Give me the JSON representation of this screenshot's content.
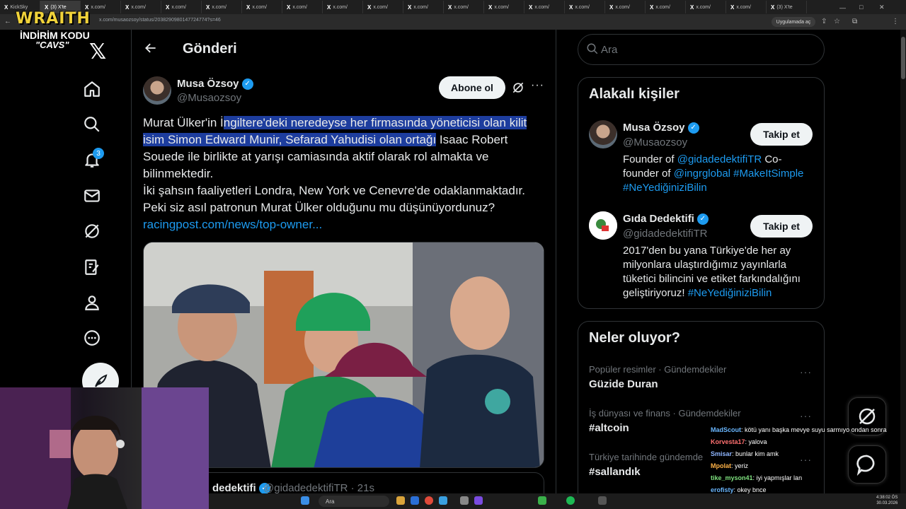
{
  "browser": {
    "tabs": [
      "KickSky",
      "(3) X'te",
      "x.com/",
      "x.com/",
      "x.com/",
      "x.com/",
      "x.com/",
      "x.com/",
      "x.com/",
      "x.com/",
      "x.com/",
      "x.com/",
      "x.com/",
      "x.com/",
      "x.com/",
      "x.com/",
      "x.com/",
      "x.com/",
      "x.com/",
      "(3) X'te"
    ],
    "url": "x.com/musaozsoy/status/2038290980147724774?s=46",
    "open_in_app": "Uygulamada aç"
  },
  "overlay": {
    "brand": "WRAITH",
    "discount": "İNDİRİM KODU",
    "code": "\"CAVS\""
  },
  "nav": {
    "notifications_count": "3"
  },
  "post": {
    "page_title": "Gönderi",
    "author_name": "Musa Özsoy",
    "author_handle": "@Musaozsoy",
    "subscribe_label": "Abone ol",
    "more": "···",
    "text_before_highlight": "Murat Ülker'in İ",
    "text_highlight": "ngiltere'deki neredeyse her firmasında yöneticisi olan kilit isim Simon Edward Munir, Sefarad Yahudisi olan ortağı",
    "text_after_highlight": " Isaac Robert Souede ile birlikte at yarışı camiasında aktif olarak rol almakta ve bilinmektedir.",
    "line2": "İki şahsın faaliyetleri Londra, New York ve Cenevre'de odaklanmaktadır.",
    "line3": "Peki siz asıl patronun Murat Ülker olduğunu mu düşünüyordunuz?",
    "link": "racingpost.com/news/top-owner..."
  },
  "reply": {
    "name": "dedektifi",
    "handle": "@gidadedektifiTR · 21s"
  },
  "search": {
    "placeholder": "Ara"
  },
  "related": {
    "title": "Alakalı kişiler",
    "people": [
      {
        "name": "Musa Özsoy",
        "handle": "@Musaozsoy",
        "follow_label": "Takip et",
        "bio_1": "Founder of ",
        "bio_link1": "@gidadedektifiTR",
        "bio_2": " Co-founder of ",
        "bio_link2": "@ingrglobal",
        "bio_3": " ",
        "bio_link3": "#MakeItSimple",
        "bio_link4": "#NeYediğiniziBilin"
      },
      {
        "name": "Gıda Dedektifi",
        "handle": "@gidadedektifiTR",
        "follow_label": "Takip et",
        "bio_1": "2017'den bu yana Türkiye'de her ay milyonlara ulaştırdığımız yayınlarla tüketici bilincini ve etiket farkındalığını geliştiriyoruz! ",
        "bio_link1": "#NeYediğiniziBilin"
      }
    ]
  },
  "trends": {
    "title": "Neler oluyor?",
    "items": [
      {
        "meta": "Popüler resimler · Gündemdekiler",
        "name": "Güzide Duran"
      },
      {
        "meta": "İş dünyası ve finans · Gündemdekiler",
        "name": "#altcoin"
      },
      {
        "meta": "Türkiye tarihinde gündemde",
        "name": "#sallandık"
      }
    ]
  },
  "chat": [
    {
      "user": "MadScout",
      "color": "#6ab7ff",
      "msg": ": kötü yanı başka mevye suyu sarmıyo ondan sonra"
    },
    {
      "user": "Korvesta17",
      "color": "#ff7070",
      "msg": ": yalova"
    },
    {
      "user": "Smisar",
      "color": "#8fb6ff",
      "msg": ": bunlar kim amk"
    },
    {
      "user": "Mpolat",
      "color": "#ffb347",
      "msg": ": yeriz"
    },
    {
      "user": "tike_myson41",
      "color": "#7ee07e",
      "msg": ": iyi yapmışlar lan"
    },
    {
      "user": "erofisty",
      "color": "#6ab7ff",
      "msg": ": okey bnce"
    }
  ],
  "taskbar": {
    "search": "Ara",
    "time": "4:38:02 ÖS",
    "date": "30.03.2026"
  }
}
